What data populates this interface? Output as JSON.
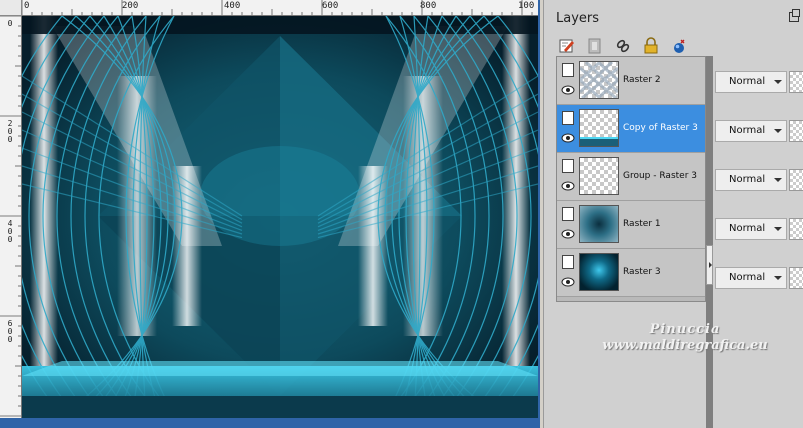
{
  "rulers": {
    "top": [
      "0",
      "200",
      "400",
      "600",
      "800",
      "100"
    ],
    "left": [
      "0",
      "200",
      "400",
      "600"
    ]
  },
  "layers_panel": {
    "title": "Layers",
    "toolbar_icons": [
      "edit-properties-icon",
      "mask-icon",
      "link-icon",
      "lock-icon",
      "new-layer-icon"
    ],
    "layers": [
      {
        "name": "Raster 2",
        "blend_mode": "Normal",
        "selected": false,
        "thumbnail": "pattern"
      },
      {
        "name": "Copy of Raster 3",
        "blend_mode": "Normal",
        "selected": true,
        "thumbnail": "transparent-stripe"
      },
      {
        "name": "Group - Raster 3",
        "blend_mode": "Normal",
        "selected": false,
        "thumbnail": "transparent"
      },
      {
        "name": "Raster 1",
        "blend_mode": "Normal",
        "selected": false,
        "thumbnail": "teal-texture"
      },
      {
        "name": "Raster 3",
        "blend_mode": "Normal",
        "selected": false,
        "thumbnail": "teal-radial"
      }
    ]
  },
  "watermark": {
    "name": "Pinuccia",
    "url": "www.maldiregrafica.eu"
  },
  "colors": {
    "selected_row": "#3c8ee0",
    "canvas_frame": "#2a6ab0",
    "artwork_base": "#0b3647",
    "artwork_accent": "#1fb4d6"
  }
}
